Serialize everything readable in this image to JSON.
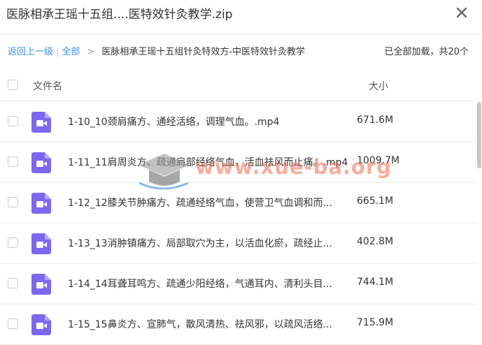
{
  "window": {
    "title": "医脉相承王瑶十五组....医特效针灸教学.zip"
  },
  "toolbar": {
    "back_label": "返回上一级",
    "all_label": "全部",
    "breadcrumb_current": "医脉相承王瑶十五组针灸特效方-中医特效针灸教学",
    "status": "已全部加载，共20个"
  },
  "table": {
    "col_name": "文件名",
    "col_size": "大小",
    "rows": [
      {
        "name": "1-10_10颈肩痛方、通经活络，调理气血。.mp4",
        "size": "671.6M"
      },
      {
        "name": "1-11_11肩周炎方、疏通肩部经络气血，活血祛风而止痛。.mp4",
        "size": "1009.7M"
      },
      {
        "name": "1-12_12膝关节肿痛方、疏通经络气血，使营卫气血调和而...",
        "size": "665.1M"
      },
      {
        "name": "1-13_13消肿镇痛方、局部取穴为主，以活血化瘀，疏经止...",
        "size": "402.8M"
      },
      {
        "name": "1-14_14耳聋耳鸣方、疏通少阳经络，气通耳内、清利头目...",
        "size": "744.1M"
      },
      {
        "name": "1-15_15鼻炎方、宣肺气，散风清热、祛风邪，以疏风活络...",
        "size": "715.9M"
      }
    ]
  },
  "watermark": {
    "text": "www.xue-ba.org"
  },
  "colors": {
    "link": "#3a8fe6",
    "file_icon": "#7b68ee",
    "watermark": "#f26b4f"
  },
  "icons": {
    "close": "close-icon",
    "file": "video-file-icon",
    "watermark_logo": "graduation-cap-icon"
  }
}
